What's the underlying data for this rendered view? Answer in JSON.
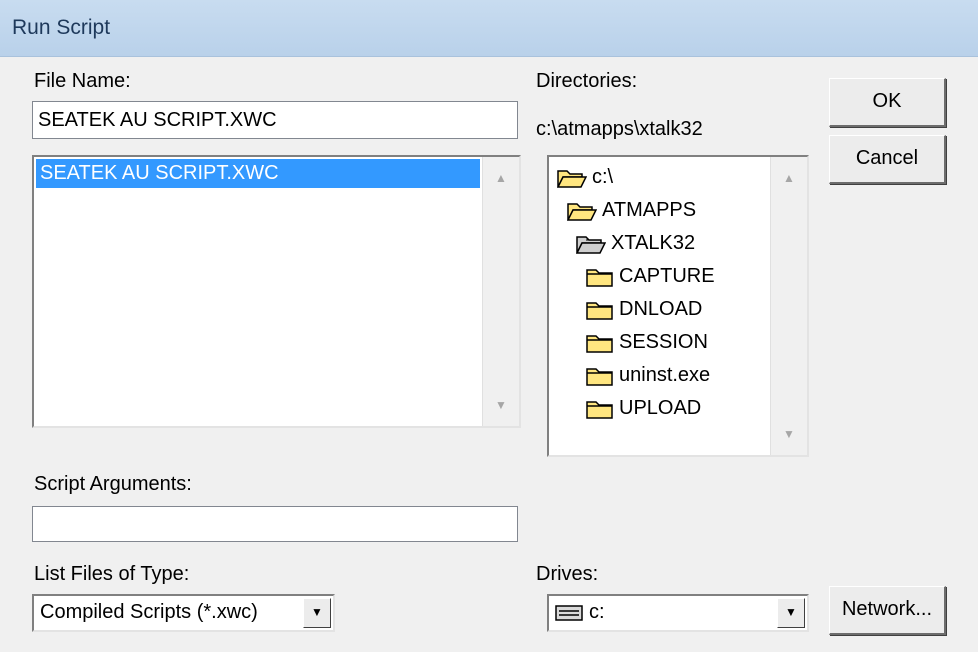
{
  "window": {
    "title": "Run Script"
  },
  "file_name": {
    "label": "File Name:",
    "value": "SEATEK AU SCRIPT.XWC",
    "files": [
      {
        "name": "SEATEK AU SCRIPT.XWC",
        "selected": true
      }
    ]
  },
  "directories": {
    "label": "Directories:",
    "current_path": "c:\\atmapps\\xtalk32",
    "tree": [
      {
        "name": "c:\\",
        "icon": "open-folder-icon",
        "level": 0
      },
      {
        "name": "ATMAPPS",
        "icon": "open-folder-icon",
        "level": 1
      },
      {
        "name": "XTALK32",
        "icon": "open-folder-current-icon",
        "level": 2
      },
      {
        "name": "CAPTURE",
        "icon": "folder-icon",
        "level": 3
      },
      {
        "name": "DNLOAD",
        "icon": "folder-icon",
        "level": 3
      },
      {
        "name": "SESSION",
        "icon": "folder-icon",
        "level": 3
      },
      {
        "name": "uninst.exe",
        "icon": "folder-icon",
        "level": 3
      },
      {
        "name": "UPLOAD",
        "icon": "folder-icon",
        "level": 3
      }
    ]
  },
  "buttons": {
    "ok": "OK",
    "cancel": "Cancel",
    "network": "Network..."
  },
  "script_arguments": {
    "label": "Script Arguments:",
    "value": ""
  },
  "list_files_of_type": {
    "label": "List Files of Type:",
    "selected": "Compiled Scripts (*.xwc)"
  },
  "drives": {
    "label": "Drives:",
    "selected": "c:",
    "icon": "drive-icon"
  },
  "colors": {
    "selection": "#3399ff",
    "folder_fill": "#ffe680",
    "titlebar": "#b9d1ea"
  }
}
